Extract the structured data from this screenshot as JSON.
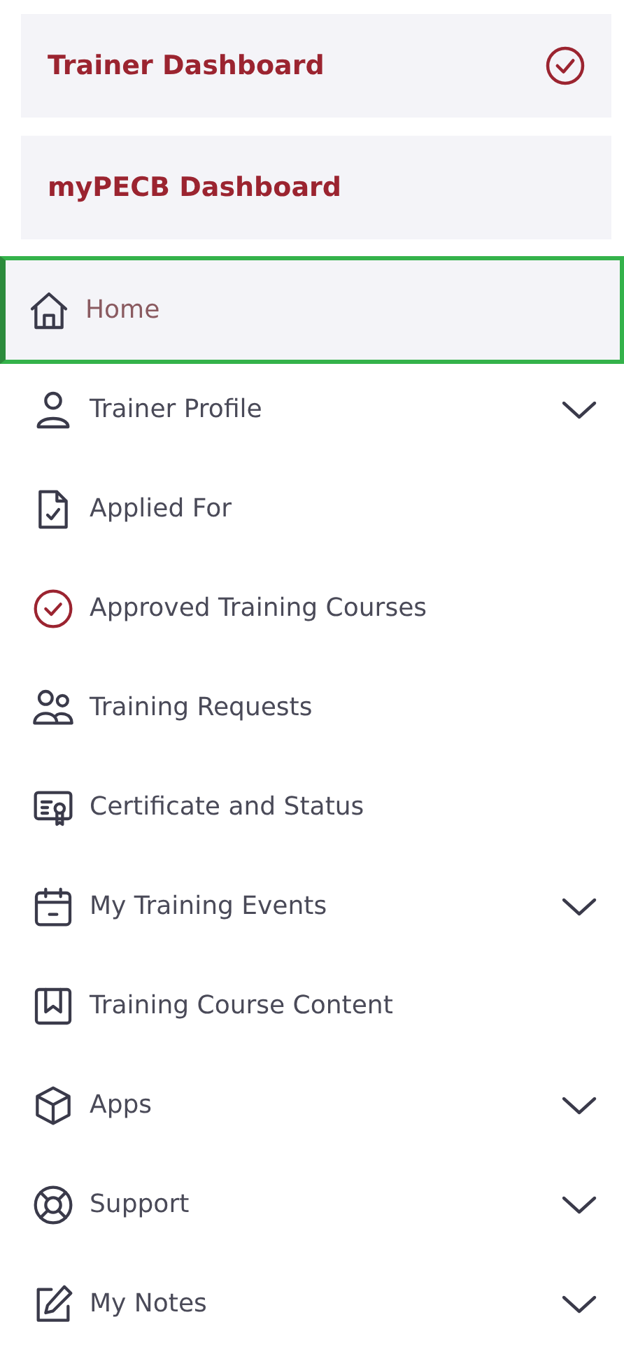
{
  "dashboards": [
    {
      "label": "Trainer Dashboard",
      "selected": true
    },
    {
      "label": "myPECB Dashboard",
      "selected": false
    }
  ],
  "menu": [
    {
      "label": "Home",
      "selected": true,
      "expandable": false
    },
    {
      "label": "Trainer Profile",
      "selected": false,
      "expandable": true
    },
    {
      "label": "Applied For",
      "selected": false,
      "expandable": false
    },
    {
      "label": "Approved Training Courses",
      "selected": false,
      "expandable": false
    },
    {
      "label": "Training Requests",
      "selected": false,
      "expandable": false
    },
    {
      "label": "Certificate and Status",
      "selected": false,
      "expandable": false
    },
    {
      "label": "My Training Events",
      "selected": false,
      "expandable": true
    },
    {
      "label": "Training Course Content",
      "selected": false,
      "expandable": false
    },
    {
      "label": "Apps",
      "selected": false,
      "expandable": true
    },
    {
      "label": "Support",
      "selected": false,
      "expandable": true
    },
    {
      "label": "My Notes",
      "selected": false,
      "expandable": true
    }
  ]
}
